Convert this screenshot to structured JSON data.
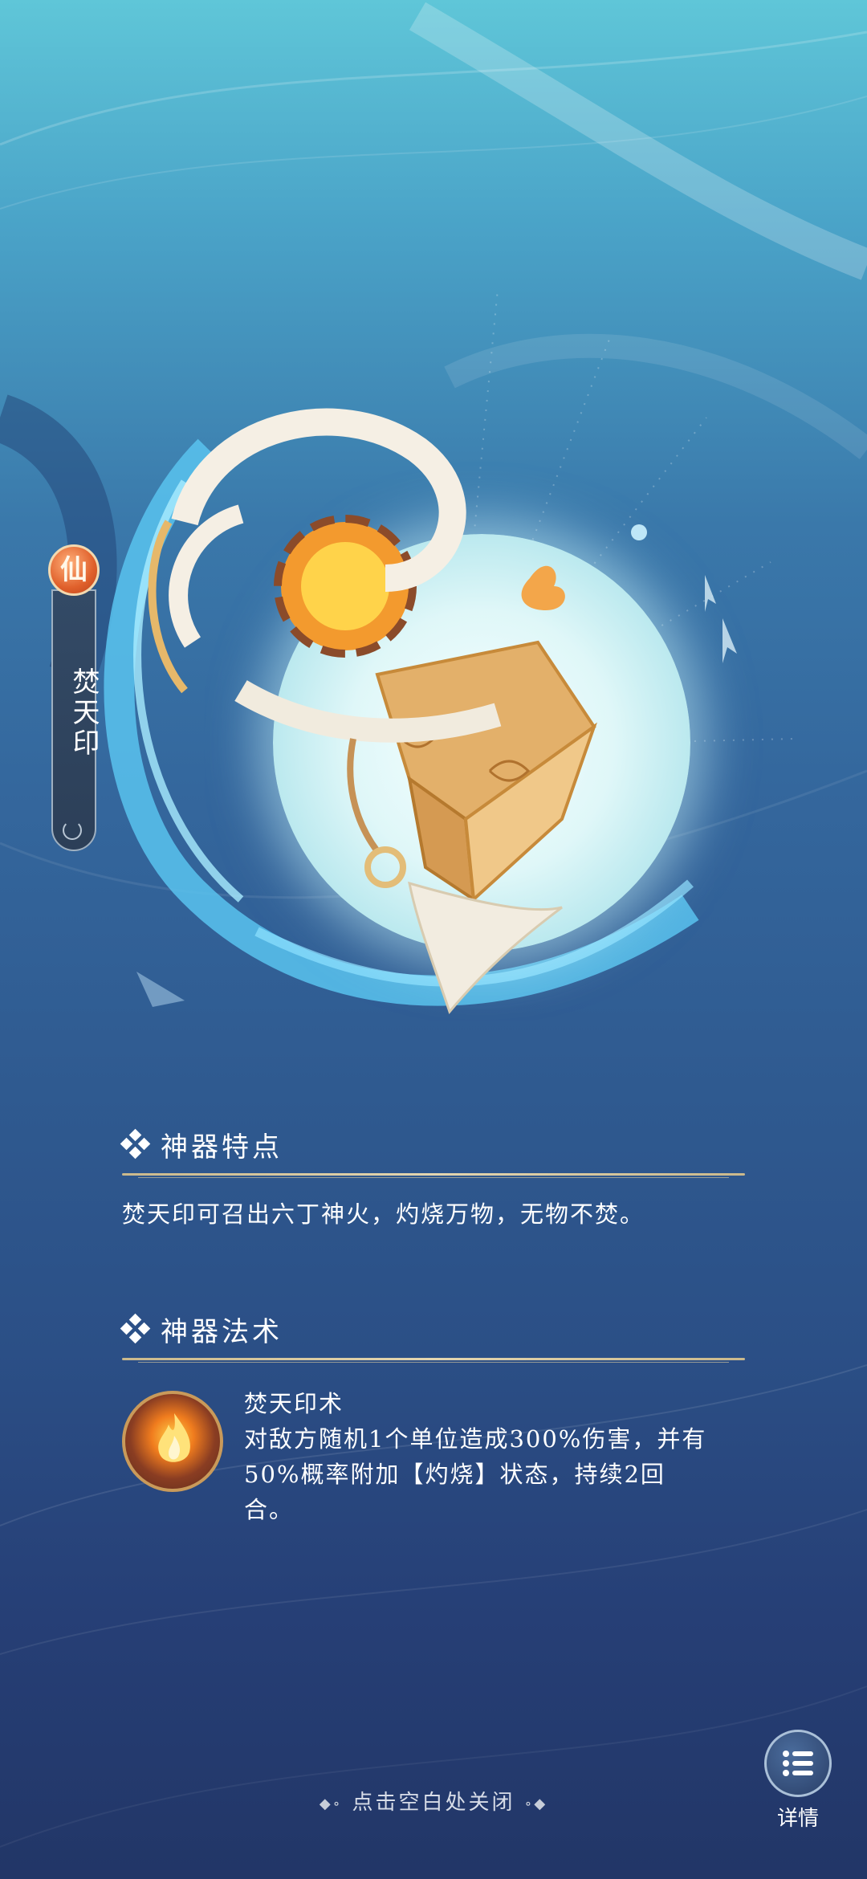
{
  "artifact": {
    "rank_badge": "仙",
    "name": "焚天印"
  },
  "features": {
    "title": "神器特点",
    "description": "焚天印可召出六丁神火，灼烧万物，无物不焚。"
  },
  "spell": {
    "title": "神器法术",
    "skill_name": "焚天印术",
    "skill_desc_line1": "对敌方随机1个单位造成300%伤害，并有",
    "skill_desc_line2": "50%概率附加【灼烧】状态，持续2回",
    "skill_desc_line3": "合。",
    "skill_icon": "fire-orb-icon"
  },
  "footer": {
    "close_hint": "点击空白处关闭",
    "details_label": "详情",
    "details_icon": "list-icon"
  },
  "colors": {
    "badge": "#e0602b",
    "divider": "#d9c89e",
    "text": "#ffffff"
  }
}
